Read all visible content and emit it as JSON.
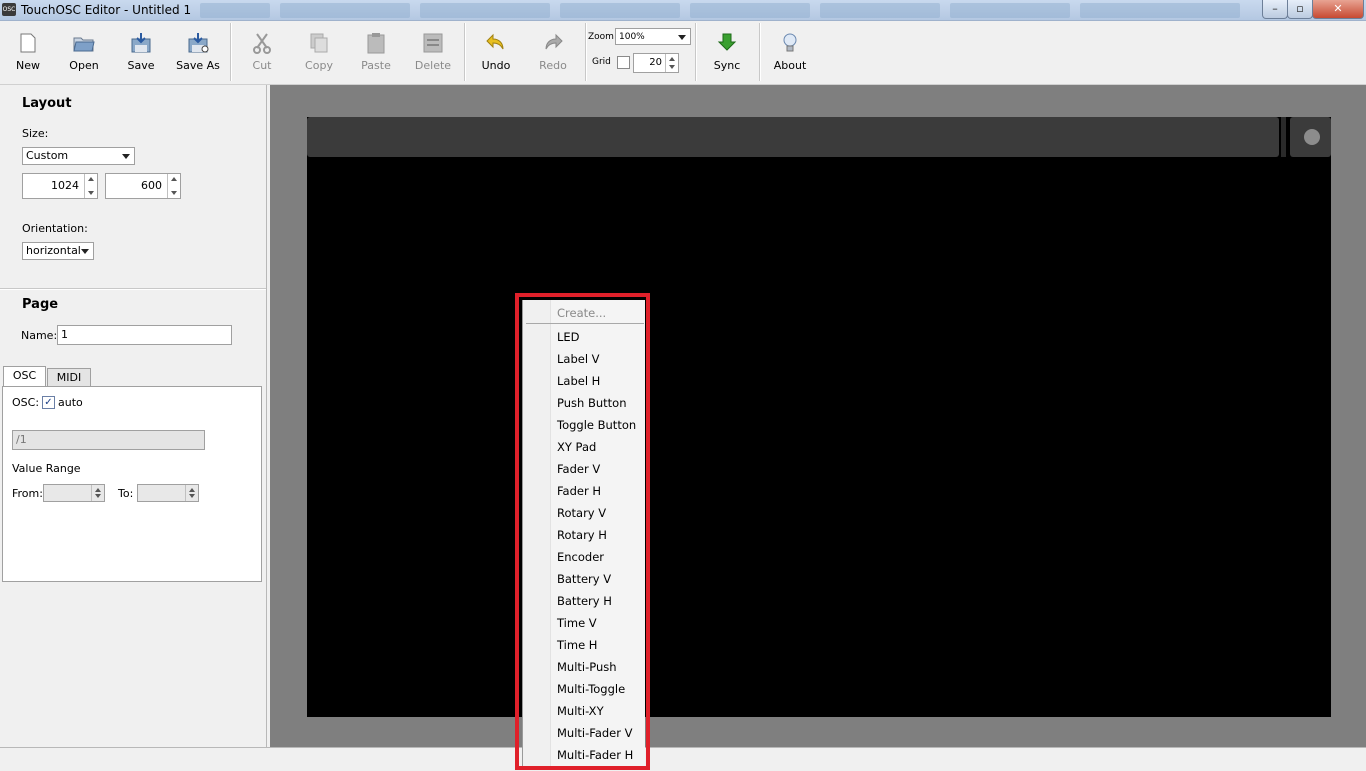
{
  "window": {
    "title": "TouchOSC Editor - Untitled 1",
    "app_icon_text": "OSC"
  },
  "toolbar": {
    "buttons": [
      {
        "label": "New"
      },
      {
        "label": "Open"
      },
      {
        "label": "Save"
      },
      {
        "label": "Save As"
      },
      {
        "label": "Cut"
      },
      {
        "label": "Copy"
      },
      {
        "label": "Paste"
      },
      {
        "label": "Delete"
      },
      {
        "label": "Undo"
      },
      {
        "label": "Redo"
      },
      {
        "label": "Sync"
      },
      {
        "label": "About"
      }
    ],
    "zoom_label": "Zoom",
    "zoom_value": "100%",
    "grid_label": "Grid",
    "grid_checked": false,
    "grid_value": "20"
  },
  "layout": {
    "title": "Layout",
    "size_label": "Size:",
    "size_value": "Custom",
    "width": "1024",
    "height": "600",
    "orientation_label": "Orientation:",
    "orientation_value": "horizontal"
  },
  "page": {
    "title": "Page",
    "name_label": "Name:",
    "name_value": "1",
    "tabs": [
      {
        "label": "OSC"
      },
      {
        "label": "MIDI"
      }
    ],
    "osc_label": "OSC:",
    "osc_auto_label": "auto",
    "osc_auto_checked": true,
    "osc_address": "/1",
    "value_range_label": "Value Range",
    "from_label": "From:",
    "to_label": "To:"
  },
  "context_menu": {
    "header": "Create...",
    "items": [
      {
        "label": "LED"
      },
      {
        "label": "Label V"
      },
      {
        "label": "Label H"
      },
      {
        "label": "Push Button"
      },
      {
        "label": "Toggle Button"
      },
      {
        "label": "XY Pad"
      },
      {
        "label": "Fader V"
      },
      {
        "label": "Fader H"
      },
      {
        "label": "Rotary V"
      },
      {
        "label": "Rotary H"
      },
      {
        "label": "Encoder"
      },
      {
        "label": "Battery V"
      },
      {
        "label": "Battery H"
      },
      {
        "label": "Time V"
      },
      {
        "label": "Time H"
      },
      {
        "label": "Multi-Push"
      },
      {
        "label": "Multi-Toggle"
      },
      {
        "label": "Multi-XY"
      },
      {
        "label": "Multi-Fader V"
      },
      {
        "label": "Multi-Fader H"
      }
    ]
  },
  "colors": {
    "highlight": "#e0202a",
    "canvas_bg": "#7f7f7f",
    "device_bg": "#000000",
    "undo_icon": "#e8c020",
    "sync_icon": "#3aa030"
  }
}
